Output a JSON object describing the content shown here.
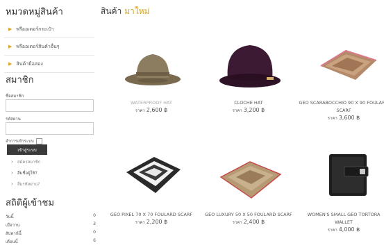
{
  "sidebar": {
    "category_title": "หมวดหมู่สินค้า",
    "categories": [
      {
        "label": "พรีออเดอร์กระเป๋า"
      },
      {
        "label": "พรีออเดอร์สินค้าอื่นๆ"
      },
      {
        "label": "สินค้ามือสอง"
      }
    ],
    "member": {
      "title": "สมาชิก",
      "username_label": "ชื่อสมาชิก",
      "username_value": "",
      "password_label": "รหัสผ่าน",
      "password_value": "",
      "remember_label": "จำการเข้าระบบ",
      "login_button": "เข้าสู่ระบบ",
      "links": [
        "สมัครสมาชิก",
        "ลืมชื่อผู้ใช้?",
        "ลืมรหัสผ่าน?"
      ]
    },
    "stats": {
      "title": "สถิติผู้เข้าชม",
      "rows": [
        {
          "label": "วันนี้",
          "value": "0"
        },
        {
          "label": "เมื่อวาน",
          "value": "3"
        },
        {
          "label": "สัปดาห์นี้",
          "value": "0"
        },
        {
          "label": "เดือนนี้",
          "value": "6"
        }
      ]
    }
  },
  "main": {
    "title_prefix": "สินค้า",
    "title_new": "มาใหม่",
    "price_label": "ราคา",
    "products": [
      {
        "name": "WATERPROOF HAT",
        "price": "2,600 ฿",
        "icon": "bucket-hat-icon",
        "color": "#8a7a5e"
      },
      {
        "name": "CLOCHE HAT",
        "price": "3,200 ฿",
        "icon": "cloche-hat-icon",
        "color": "#3a1830"
      },
      {
        "name": "GEO SCARABOCCHIO 90 X 90 FOULARD SCARF",
        "price": "3,600 ฿",
        "icon": "scarf-icon",
        "color": "#b48a6a"
      },
      {
        "name": "GEO PIXEL 70 X 70 FOULARD SCARF",
        "price": "2,200 ฿",
        "icon": "scarf-pixel-icon",
        "color": "#2a2a2a"
      },
      {
        "name": "GEO LUXURY 50 X 50 FOULARD SCARF",
        "price": "2,400 ฿",
        "icon": "scarf-luxury-icon",
        "color": "#b59a74"
      },
      {
        "name": "WOMEN'S SMALL GEO TORTORA WALLET",
        "price": "4,000 ฿",
        "icon": "wallet-icon",
        "color": "#1e1e1e"
      }
    ]
  }
}
